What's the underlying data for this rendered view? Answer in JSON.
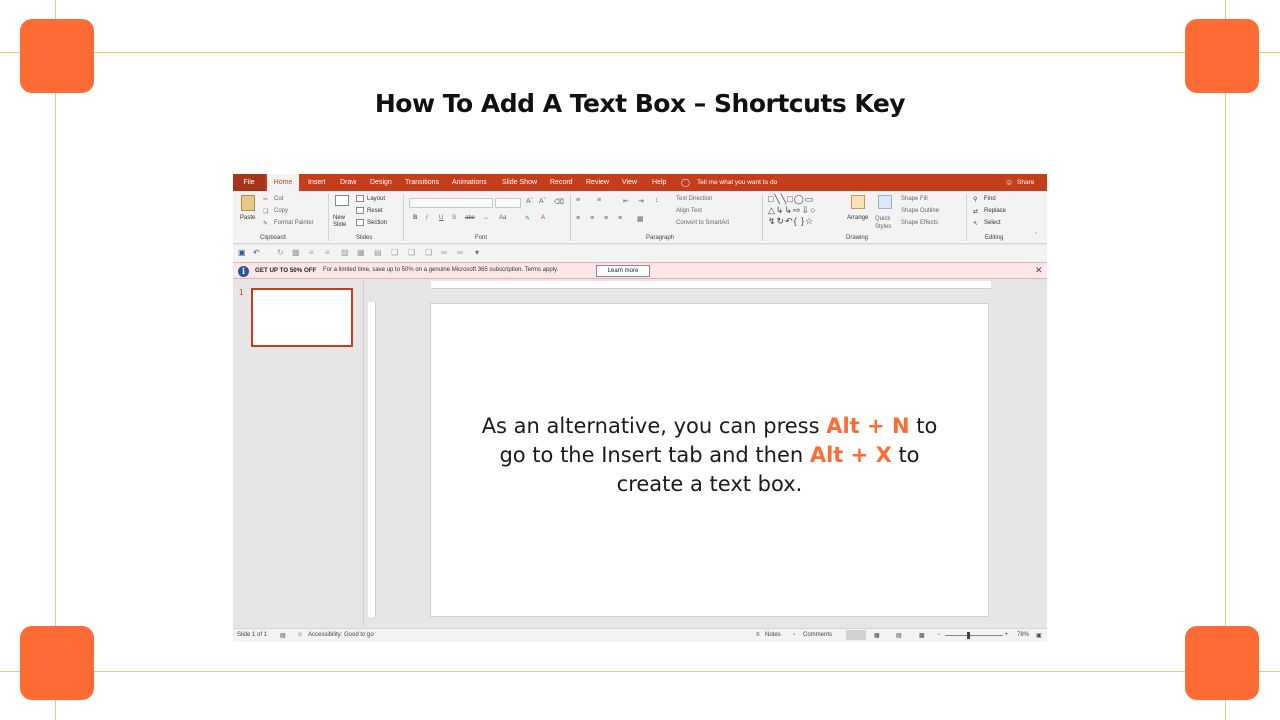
{
  "slide": {
    "title": "How To Add A Text Box – Shortcuts Key"
  },
  "menu": {
    "tabs": [
      "File",
      "Home",
      "Insert",
      "Draw",
      "Design",
      "Transitions",
      "Animations",
      "Slide Show",
      "Record",
      "Review",
      "View",
      "Help"
    ],
    "active_tab": "Home",
    "tell_me": "Tell me what you want to do",
    "share": "Share"
  },
  "ribbon": {
    "clipboard": {
      "paste": "Paste",
      "cut": "Cut",
      "copy": "Copy",
      "format_painter": "Format Painter",
      "label": "Clipboard"
    },
    "slides": {
      "new_slide": "New Slide",
      "layout": "Layout",
      "reset": "Reset",
      "section": "Section",
      "label": "Slides"
    },
    "font": {
      "label": "Font",
      "bold": "B",
      "italic": "I",
      "underline": "U",
      "strike": "S"
    },
    "paragraph": {
      "text_direction": "Text Direction",
      "align_text": "Align Text",
      "convert_smartart": "Convert to SmartArt",
      "label": "Paragraph"
    },
    "drawing": {
      "arrange": "Arrange",
      "quick_styles": "Quick Styles",
      "shape_fill": "Shape Fill",
      "shape_outline": "Shape Outline",
      "shape_effects": "Shape Effects",
      "label": "Drawing"
    },
    "editing": {
      "find": "Find",
      "replace": "Replace",
      "select": "Select",
      "label": "Editing"
    }
  },
  "promo": {
    "headline": "GET UP TO 50% OFF",
    "text": "For a limited time, save up to 50% on a genuine Microsoft 365 subscription. Terms apply.",
    "button": "Learn more"
  },
  "thumbnails": {
    "number": "1"
  },
  "canvas": {
    "line1_pre": "As an alternative, you can press ",
    "line1_key": "Alt + N",
    "line1_post": " to",
    "line2_pre": "go to the Insert tab and then ",
    "line2_key": "Alt + X",
    "line2_post": " to",
    "line3": "create a text box."
  },
  "status": {
    "slide_count": "Slide 1 of 1",
    "accessibility": "Accessibility: Good to go",
    "notes": "Notes",
    "comments": "Comments",
    "zoom": "78%"
  },
  "colors": {
    "accent": "#ff6b35",
    "frame": "#f4c66e",
    "office_brand": "#c43e1c"
  }
}
